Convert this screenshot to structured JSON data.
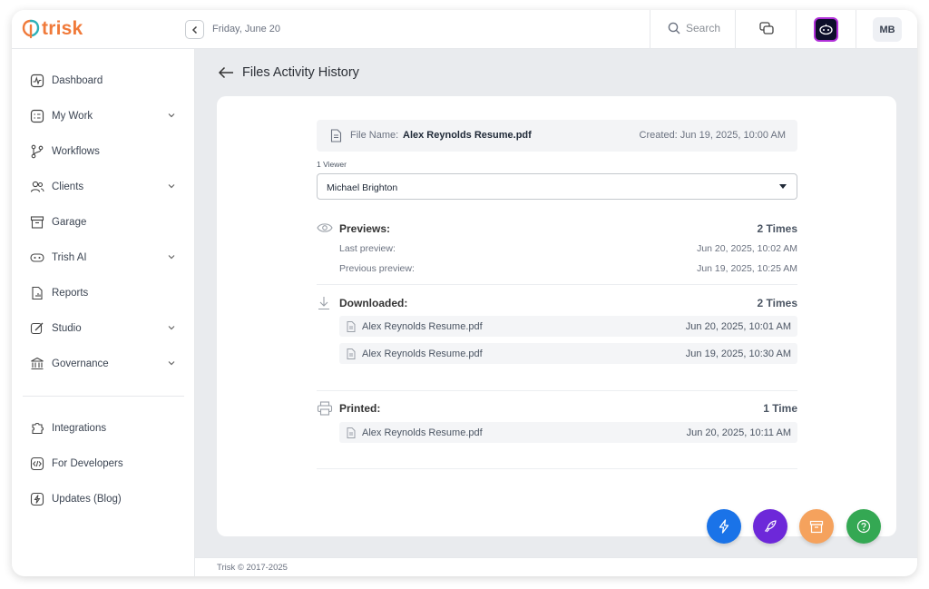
{
  "app": {
    "brand": "trisk",
    "brand_color": "#f07a3a"
  },
  "topbar": {
    "date": "Friday, June 20",
    "search_label": "Search",
    "avatar_initials": "MB"
  },
  "sidebar": {
    "items": [
      {
        "label": "Dashboard",
        "icon": "dashboard-icon",
        "has_chevron": false
      },
      {
        "label": "My Work",
        "icon": "my-work-icon",
        "has_chevron": true
      },
      {
        "label": "Workflows",
        "icon": "workflows-icon",
        "has_chevron": false
      },
      {
        "label": "Clients",
        "icon": "clients-icon",
        "has_chevron": true
      },
      {
        "label": "Garage",
        "icon": "garage-icon",
        "has_chevron": false
      },
      {
        "label": "Trish AI",
        "icon": "trish-ai-icon",
        "has_chevron": true
      },
      {
        "label": "Reports",
        "icon": "reports-icon",
        "has_chevron": false
      },
      {
        "label": "Studio",
        "icon": "studio-icon",
        "has_chevron": true
      },
      {
        "label": "Governance",
        "icon": "governance-icon",
        "has_chevron": true
      }
    ],
    "secondary": [
      {
        "label": "Integrations",
        "icon": "integrations-icon"
      },
      {
        "label": "For Developers",
        "icon": "code-icon"
      },
      {
        "label": "Updates (Blog)",
        "icon": "blog-icon"
      }
    ]
  },
  "page": {
    "title": "Files Activity History",
    "file": {
      "name_label": "File Name:",
      "name": "Alex Reynolds Resume.pdf",
      "created": "Created: Jun 19, 2025, 10:00 AM"
    },
    "viewer_count": "1 Viewer",
    "viewer_selected": "Michael Brighton",
    "previews": {
      "title": "Previews:",
      "count": "2 Times",
      "rows": [
        {
          "label": "Last preview:",
          "value": "Jun 20, 2025, 10:02 AM"
        },
        {
          "label": "Previous preview:",
          "value": "Jun 19, 2025, 10:25 AM"
        }
      ]
    },
    "downloaded": {
      "title": "Downloaded:",
      "count": "2 Times",
      "rows": [
        {
          "file": "Alex Reynolds Resume.pdf",
          "date": "Jun 20, 2025, 10:01 AM"
        },
        {
          "file": "Alex Reynolds Resume.pdf",
          "date": "Jun 19, 2025, 10:30 AM"
        }
      ]
    },
    "printed": {
      "title": "Printed:",
      "count": "1 Time",
      "rows": [
        {
          "file": "Alex Reynolds Resume.pdf",
          "date": "Jun 20, 2025, 10:11 AM"
        }
      ]
    }
  },
  "footer": {
    "copyright": "Trisk © 2017-2025"
  },
  "fabs": [
    {
      "name": "quick-action-fab",
      "icon": "lightning-icon",
      "color": "#1a73e8"
    },
    {
      "name": "launch-fab",
      "icon": "rocket-icon",
      "color": "#6d28d9"
    },
    {
      "name": "archive-fab",
      "icon": "archive-icon",
      "color": "#f5a25d"
    },
    {
      "name": "help-fab",
      "icon": "help-icon",
      "color": "#34a853"
    }
  ]
}
